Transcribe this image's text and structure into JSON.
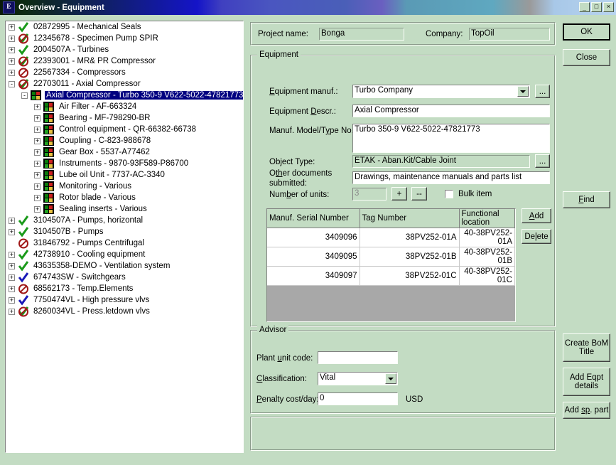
{
  "window": {
    "title": "Overview - Equipment",
    "icon": "E",
    "minimize": "_",
    "maximize": "□",
    "close": "×"
  },
  "tree": {
    "items": [
      {
        "expander": "+",
        "icon": "check",
        "label": "02872995  - Mechanical Seals",
        "indent": 0,
        "selected": false
      },
      {
        "expander": "+",
        "icon": "ban-check",
        "label": "12345678  - Specimen Pump SPIR",
        "indent": 0,
        "selected": false
      },
      {
        "expander": "+",
        "icon": "check",
        "label": "2004507A - Turbines",
        "indent": 0,
        "selected": false
      },
      {
        "expander": "+",
        "icon": "ban-check",
        "label": "22393001 - MR& PR Compressor",
        "indent": 0,
        "selected": false
      },
      {
        "expander": "+",
        "icon": "ban",
        "label": "22567334 - Compressors",
        "indent": 0,
        "selected": false
      },
      {
        "expander": "-",
        "icon": "ban-check",
        "label": "22703011 - Axial Compressor",
        "indent": 0,
        "selected": false
      },
      {
        "expander": "-",
        "icon": "square",
        "label": "Axial Compressor - Turbo 350-9 V622-5022-47821773",
        "indent": 1,
        "selected": true
      },
      {
        "expander": "+",
        "icon": "square",
        "label": "Air Filter - AF-663324",
        "indent": 2,
        "selected": false
      },
      {
        "expander": "+",
        "icon": "square",
        "label": "Bearing - MF-798290-BR",
        "indent": 2,
        "selected": false
      },
      {
        "expander": "+",
        "icon": "square",
        "label": "Control equipment - QR-66382-66738",
        "indent": 2,
        "selected": false
      },
      {
        "expander": "+",
        "icon": "square",
        "label": "Coupling - C-823-988678",
        "indent": 2,
        "selected": false
      },
      {
        "expander": "+",
        "icon": "square",
        "label": "Gear Box - 5537-A77462",
        "indent": 2,
        "selected": false
      },
      {
        "expander": "+",
        "icon": "square",
        "label": "Instruments - 9870-93F589-P86700",
        "indent": 2,
        "selected": false
      },
      {
        "expander": "+",
        "icon": "square",
        "label": "Lube oil Unit - 7737-AC-3340",
        "indent": 2,
        "selected": false
      },
      {
        "expander": "+",
        "icon": "square",
        "label": "Monitoring - Various",
        "indent": 2,
        "selected": false
      },
      {
        "expander": "+",
        "icon": "square",
        "label": "Rotor blade - Various",
        "indent": 2,
        "selected": false
      },
      {
        "expander": "+",
        "icon": "square",
        "label": "Sealing inserts - Various",
        "indent": 2,
        "selected": false
      },
      {
        "expander": "+",
        "icon": "check",
        "label": "3104507A - Pumps, horizontal",
        "indent": 0,
        "selected": false
      },
      {
        "expander": "+",
        "icon": "check",
        "label": "3104507B - Pumps",
        "indent": 0,
        "selected": false
      },
      {
        "expander": "",
        "icon": "ban",
        "label": "31846792 - Pumps Centrifugal",
        "indent": 0,
        "selected": false
      },
      {
        "expander": "+",
        "icon": "check",
        "label": "42738910 - Cooling equipment",
        "indent": 0,
        "selected": false
      },
      {
        "expander": "+",
        "icon": "check",
        "label": "43635358-DEMO  - Ventilation system",
        "indent": 0,
        "selected": false
      },
      {
        "expander": "+",
        "icon": "blue-check",
        "label": "674743SW  - Switchgears",
        "indent": 0,
        "selected": false
      },
      {
        "expander": "+",
        "icon": "ban",
        "label": "68562173 - Temp.Elements",
        "indent": 0,
        "selected": false
      },
      {
        "expander": "+",
        "icon": "blue-check",
        "label": "7750474VL  - High pressure vlvs",
        "indent": 0,
        "selected": false
      },
      {
        "expander": "+",
        "icon": "ban-check",
        "label": "8260034VL  - Press.letdown vlvs",
        "indent": 0,
        "selected": false
      }
    ]
  },
  "header": {
    "project_label": "Project name:",
    "project_value": "Bonga",
    "company_label": "Company:",
    "company_value": "TopOil"
  },
  "equipment": {
    "group_title": "Equipment",
    "manuf_label": "Equipment manuf.:",
    "manuf_value": "Turbo Company",
    "manuf_browse": "...",
    "descr_label": "Equipment Descr.:",
    "descr_value": "Axial Compressor",
    "model_label": "Manuf. Model/Type No.:",
    "model_value": "Turbo 350-9 V622-5022-47821773",
    "object_type_label": "Object Type:",
    "object_type_value": "ETAK - Aban.Kit/Cable Joint",
    "object_type_browse": "...",
    "other_docs_label_line1": "Other documents",
    "other_docs_label_line2": "submitted:",
    "other_docs_value": "Drawings, maintenance manuals and parts list",
    "units_label": "Number of units:",
    "units_value": "3",
    "units_plus": "+",
    "units_minus": "--",
    "bulk_label": "Bulk item",
    "bulk_checked": false
  },
  "grid": {
    "columns": [
      "Manuf. Serial Number",
      "Tag Number",
      "Functional location"
    ],
    "rows": [
      [
        "3409096",
        "38PV252-01A",
        "40-38PV252-01A"
      ],
      [
        "3409095",
        "38PV252-01B",
        "40-38PV252-01B"
      ],
      [
        "3409097",
        "38PV252-01C",
        "40-38PV252-01C"
      ]
    ],
    "add_button": "Add",
    "delete_button": "Delete"
  },
  "advisor": {
    "group_title": "Advisor",
    "plant_unit_label": "Plant unit code:",
    "plant_unit_value": "",
    "classification_label": "Classification:",
    "classification_value": "Vital",
    "penalty_label": "Penalty cost/day:",
    "penalty_value": "0",
    "penalty_unit": "USD"
  },
  "buttons": {
    "ok": "OK",
    "close": "Close",
    "find": "Find",
    "create_bom": "Create BoM Title",
    "add_eqpt": "Add Eqpt details",
    "add_sp_part": "Add sp. part"
  },
  "colors": {
    "dialog_bg": "#c3dcc3",
    "title_start": "#0d2a12",
    "title_blue": "#1414c8",
    "selection": "#000080",
    "field_bg": "#ffffff"
  }
}
